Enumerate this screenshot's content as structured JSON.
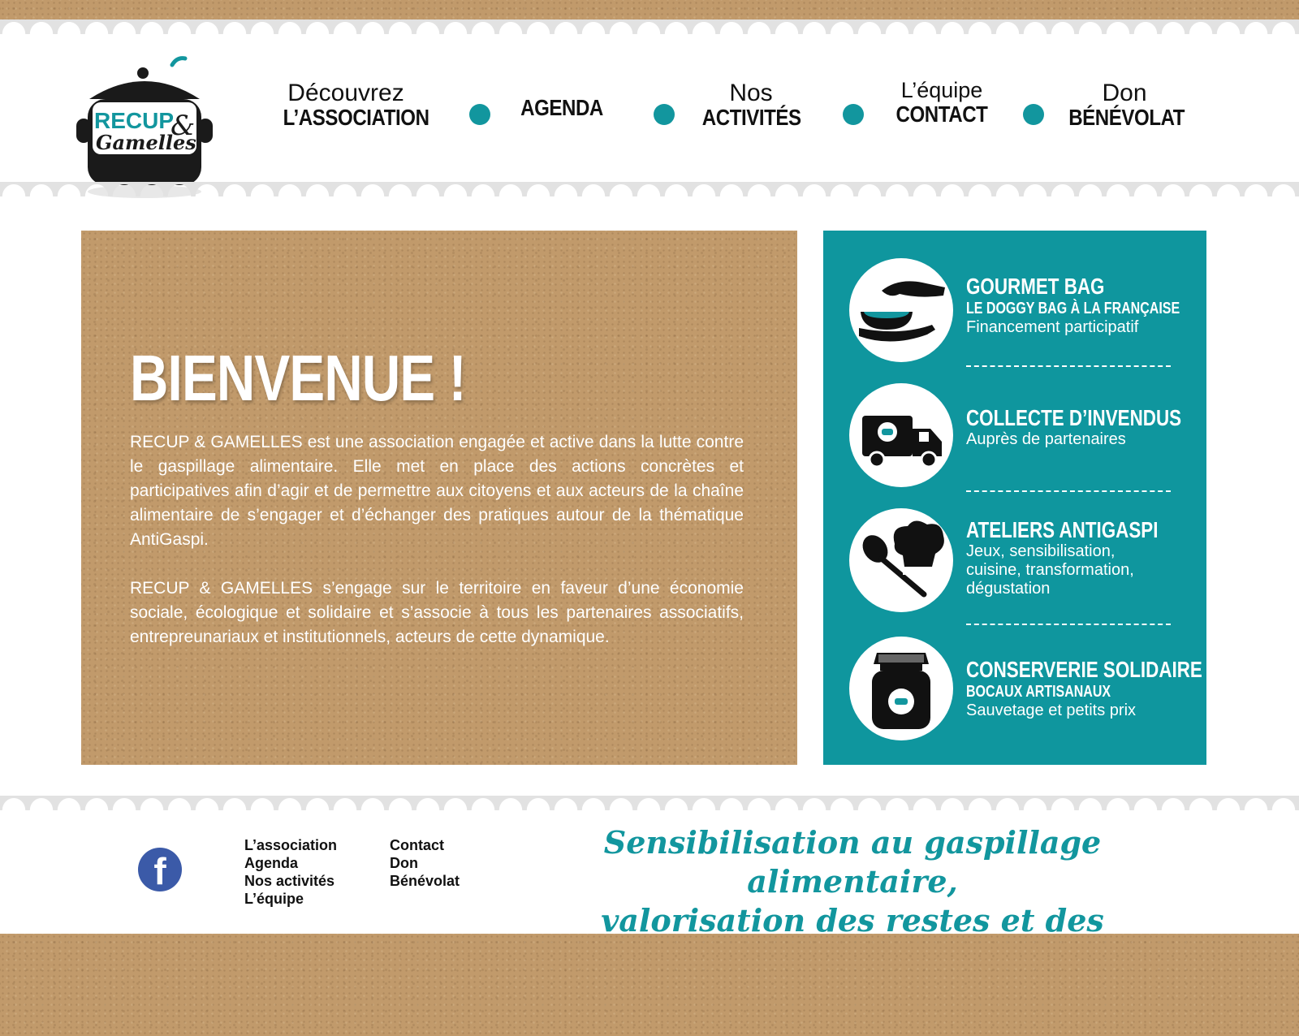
{
  "brand": {
    "logo_line1": "RECUP",
    "logo_amp": "&",
    "logo_line2": "Gamelles",
    "accent_color": "#12969e",
    "kraft_color": "#c19a6b"
  },
  "nav": {
    "items": [
      {
        "line1": "Découvrez",
        "line2": "L’ASSOCIATION"
      },
      {
        "line1": "",
        "line2": "AGENDA"
      },
      {
        "line1": "Nos",
        "line2": "ACTIVITÉS"
      },
      {
        "line1": "L’équipe",
        "line2": "CONTACT"
      },
      {
        "line1": "Don",
        "line2": "BÉNÉVOLAT"
      }
    ]
  },
  "welcome": {
    "title": "BIENVENUE !",
    "paragraph1": "RECUP & GAMELLES est une association engagée et active dans la lutte contre le gaspillage alimentaire. Elle met en place des actions concrètes et participatives afin d’agir et de permettre aux citoyens et aux acteurs de la chaîne alimentaire de s’engager et d’échanger des pratiques autour de la thématique AntiGaspi.",
    "paragraph2": "RECUP & GAMELLES s’engage sur le territoire en faveur d’une économie sociale, écologique et solidaire et s’associe à tous les partenaires associatifs, entrepreunariaux et institutionnels, acteurs de cette dynamique."
  },
  "services": [
    {
      "icon": "hand-bowl-icon",
      "title": "GOURMET BAG",
      "subtitle": "LE DOGGY BAG À LA FRANÇAISE",
      "description": "Financement participatif"
    },
    {
      "icon": "truck-icon",
      "title": "COLLECTE D’INVENDUS",
      "subtitle": "",
      "description": "Auprès de partenaires"
    },
    {
      "icon": "chef-hat-spoon-icon",
      "title": "ATELIERS ANTIGASPI",
      "subtitle": "",
      "description": "Jeux, sensibilisation, cuisine, transformation, dégustation"
    },
    {
      "icon": "jar-icon",
      "title": "CONSERVERIE SOLIDAIRE",
      "subtitle": "BOCAUX ARTISANAUX",
      "description": "Sauvetage et petits prix"
    }
  ],
  "footer": {
    "facebook_icon": "facebook-icon",
    "col1": [
      "L’association",
      "Agenda",
      "Nos activités",
      "L’équipe"
    ],
    "col2": [
      "Contact",
      "Don",
      "Bénévolat"
    ],
    "tagline_line1": "Sensibilisation au gaspillage alimentaire,",
    "tagline_line2": "valorisation des restes et des invendus !"
  }
}
